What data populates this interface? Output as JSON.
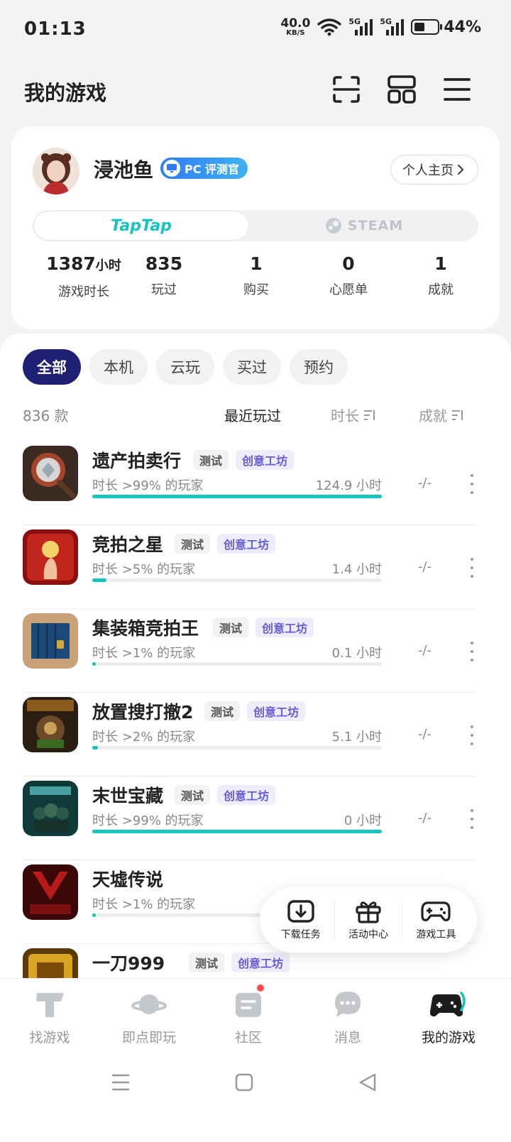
{
  "status": {
    "time": "01:13",
    "net_speed": "40.0",
    "net_unit": "KB/S",
    "sig1": "5G",
    "sig2": "5G",
    "battery": "44%",
    "battery_level": 0.44
  },
  "header": {
    "title": "我的游戏",
    "icons": [
      "scan-icon",
      "grid-icon",
      "menu-icon"
    ]
  },
  "profile": {
    "name": "浸池鱼",
    "badge": "PC 评测官",
    "homepage": "个人主页",
    "platforms": {
      "taptap": "TapTap",
      "steam": "STEAM"
    },
    "stats": [
      {
        "value": "1387",
        "unit": "小时",
        "label": "游戏时长"
      },
      {
        "value": "835",
        "label": "玩过"
      },
      {
        "value": "1",
        "label": "购买"
      },
      {
        "value": "0",
        "label": "心愿单"
      },
      {
        "value": "1",
        "label": "成就"
      }
    ]
  },
  "filters": [
    "全部",
    "本机",
    "云玩",
    "买过",
    "预约"
  ],
  "sort": {
    "count": "836 款",
    "recent": "最近玩过",
    "duration": "时长",
    "achievement": "成就"
  },
  "games": [
    {
      "name": "遗产拍卖行",
      "tag_test": "测试",
      "tag_ws": "创意工坊",
      "sub": "时长 >99% 的玩家",
      "hours": "124.9 小时",
      "progress": 1.0,
      "ach": "-/-"
    },
    {
      "name": "竞拍之星",
      "tag_test": "测试",
      "tag_ws": "创意工坊",
      "sub": "时长 >5% 的玩家",
      "hours": "1.4 小时",
      "progress": 0.05,
      "ach": "-/-"
    },
    {
      "name": "集装箱竞拍王",
      "tag_test": "测试",
      "tag_ws": "创意工坊",
      "sub": "时长 >1% 的玩家",
      "hours": "0.1 小时",
      "progress": 0.01,
      "ach": "-/-"
    },
    {
      "name": "放置搜打撤2",
      "tag_test": "测试",
      "tag_ws": "创意工坊",
      "sub": "时长 >2% 的玩家",
      "hours": "5.1 小时",
      "progress": 0.02,
      "ach": "-/-"
    },
    {
      "name": "末世宝藏",
      "tag_test": "测试",
      "tag_ws": "创意工坊",
      "sub": "时长 >99% 的玩家",
      "hours": "0 小时",
      "progress": 1.0,
      "ach": "-/-"
    },
    {
      "name": "天墟传说",
      "sub": "时长 >1% 的玩家",
      "progress": 0.01
    },
    {
      "name": "一刀999",
      "tag_test": "测试",
      "tag_ws": "创意工坊"
    }
  ],
  "float_menu": [
    "下载任务",
    "活动中心",
    "游戏工具"
  ],
  "bottom_nav": [
    "找游戏",
    "即点即玩",
    "社区",
    "消息",
    "我的游戏"
  ]
}
